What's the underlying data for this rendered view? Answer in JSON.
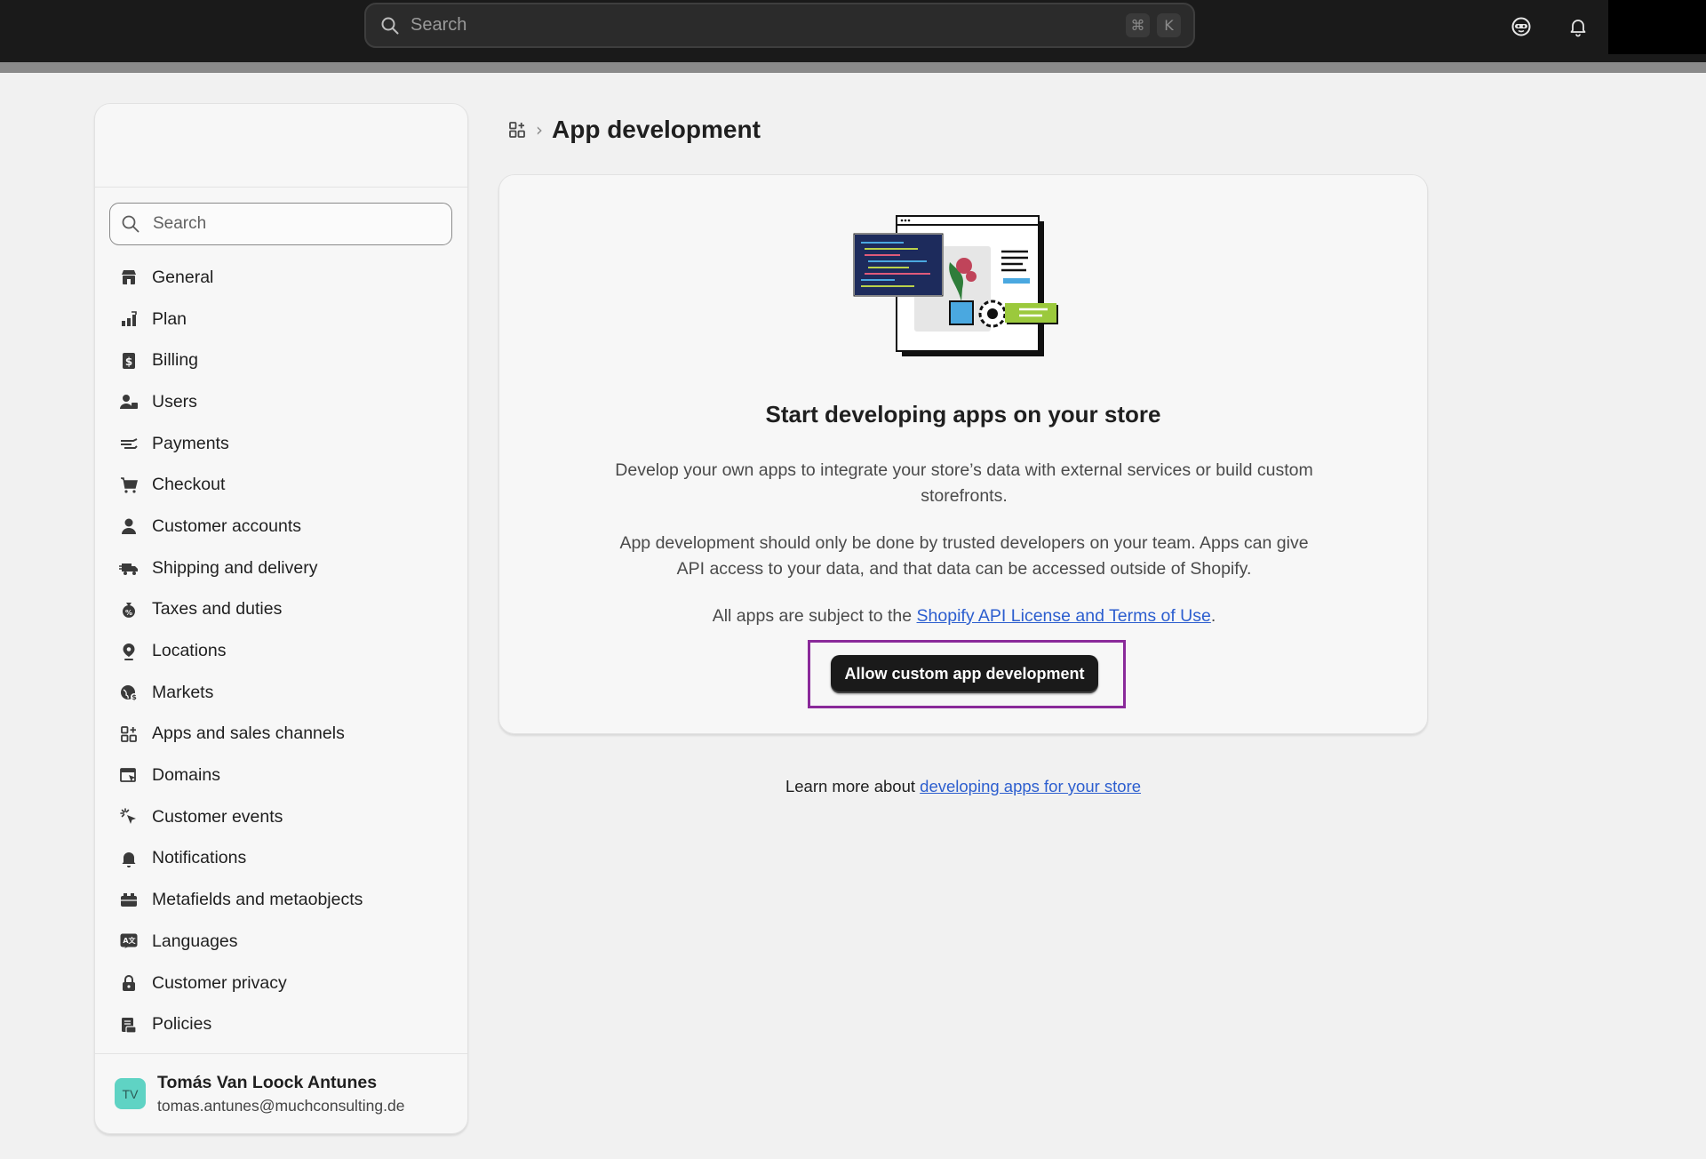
{
  "topbar": {
    "search_placeholder": "Search",
    "shortcut_keys": [
      "⌘",
      "K"
    ],
    "icons": [
      "search-icon",
      "mascot-icon",
      "bell-icon"
    ]
  },
  "sidebar": {
    "search_placeholder": "Search",
    "items": [
      {
        "label": "General",
        "icon": "store-icon"
      },
      {
        "label": "Plan",
        "icon": "plan-icon"
      },
      {
        "label": "Billing",
        "icon": "billing-icon"
      },
      {
        "label": "Users",
        "icon": "users-icon"
      },
      {
        "label": "Payments",
        "icon": "payments-icon"
      },
      {
        "label": "Checkout",
        "icon": "cart-icon"
      },
      {
        "label": "Customer accounts",
        "icon": "person-icon"
      },
      {
        "label": "Shipping and delivery",
        "icon": "truck-icon"
      },
      {
        "label": "Taxes and duties",
        "icon": "tax-icon"
      },
      {
        "label": "Locations",
        "icon": "location-icon"
      },
      {
        "label": "Markets",
        "icon": "globe-icon"
      },
      {
        "label": "Apps and sales channels",
        "icon": "apps-icon"
      },
      {
        "label": "Domains",
        "icon": "domains-icon"
      },
      {
        "label": "Customer events",
        "icon": "cursor-click-icon"
      },
      {
        "label": "Notifications",
        "icon": "bell-icon"
      },
      {
        "label": "Metafields and metaobjects",
        "icon": "metafields-icon"
      },
      {
        "label": "Languages",
        "icon": "language-icon"
      },
      {
        "label": "Customer privacy",
        "icon": "lock-icon"
      },
      {
        "label": "Policies",
        "icon": "policy-icon"
      }
    ],
    "user": {
      "initials": "TV",
      "name": "Tomás Van Loock Antunes",
      "email": "tomas.antunes@muchconsulting.de"
    }
  },
  "breadcrumb": {
    "icon": "apps-icon",
    "separator": "›",
    "title": "App development"
  },
  "card": {
    "title": "Start developing apps on your store",
    "paragraph1": "Develop your own apps to integrate your store’s data with external services or build custom storefronts.",
    "paragraph2": "App development should only be done by trusted developers on your team. Apps can give API access to your data, and that data can be accessed outside of Shopify.",
    "paragraph3_prefix": "All apps are subject to the ",
    "paragraph3_link": "Shopify API License and Terms of Use",
    "paragraph3_suffix": ".",
    "button_label": "Allow custom app development"
  },
  "footer": {
    "learn_more_prefix": "Learn more about ",
    "learn_more_link": "developing apps for your store"
  },
  "colors": {
    "topbar": "#1a1a1a",
    "page_bg": "#f1f1f1",
    "link": "#2c5ecf",
    "primary_button": "#1a1a1a",
    "highlight_border": "#8a2a9a",
    "avatar_bg": "#5fd3c4"
  }
}
